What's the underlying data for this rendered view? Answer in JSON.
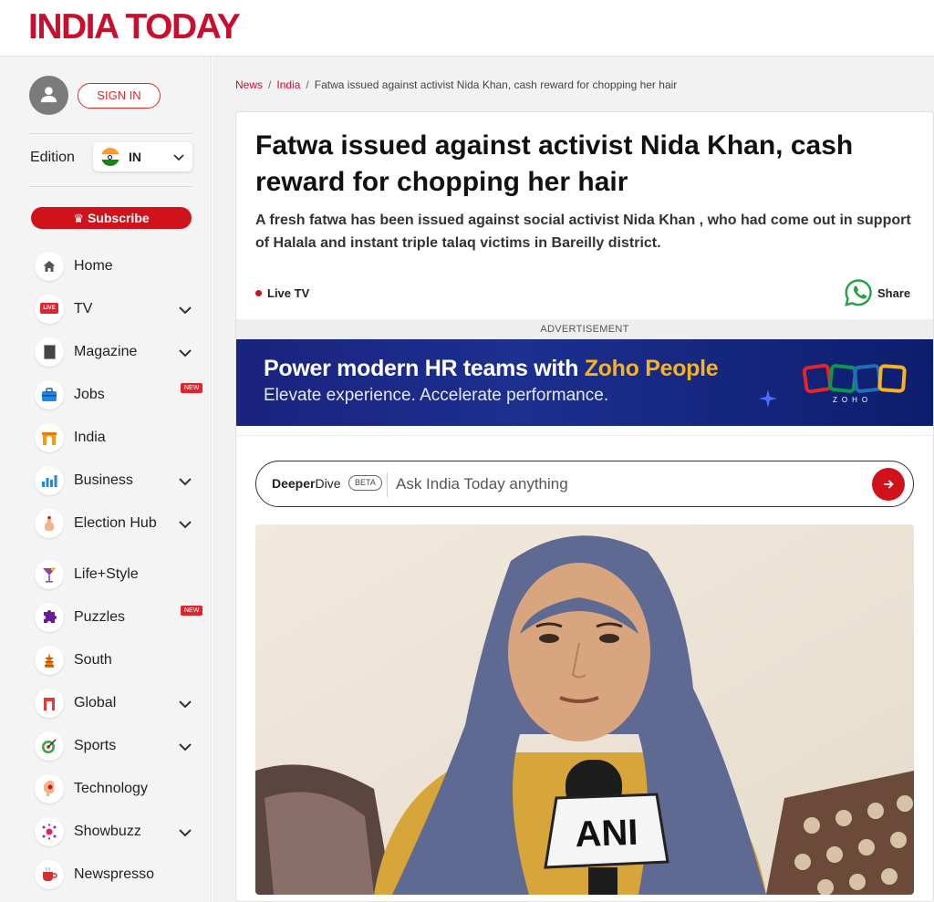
{
  "header": {
    "logo": "INDIA TODAY"
  },
  "sidebar": {
    "signin_label": "SIGN IN",
    "edition_label": "Edition",
    "edition_code": "IN",
    "subscribe_label": "Subscribe",
    "items": [
      {
        "label": "Home",
        "icon": "home-icon",
        "has_chevron": false
      },
      {
        "label": "TV",
        "icon": "live-tv-icon",
        "icon_text": "LIVE",
        "has_chevron": true
      },
      {
        "label": "Magazine",
        "icon": "magazine-icon",
        "has_chevron": true
      },
      {
        "label": "Jobs",
        "icon": "briefcase-icon",
        "has_chevron": false,
        "badge": "NEW"
      },
      {
        "label": "India",
        "icon": "india-gate-icon",
        "has_chevron": false
      },
      {
        "label": "Business",
        "icon": "bar-chart-icon",
        "has_chevron": true
      },
      {
        "label": "Election Hub",
        "icon": "voting-hand-icon",
        "has_chevron": true
      },
      {
        "label": "Life+Style",
        "icon": "cocktail-icon",
        "has_chevron": false
      },
      {
        "label": "Puzzles",
        "icon": "puzzle-icon",
        "has_chevron": false,
        "badge": "NEW"
      },
      {
        "label": "South",
        "icon": "temple-icon",
        "has_chevron": false
      },
      {
        "label": "Global",
        "icon": "globe-gate-icon",
        "has_chevron": true
      },
      {
        "label": "Sports",
        "icon": "target-icon",
        "has_chevron": true
      },
      {
        "label": "Technology",
        "icon": "brain-chip-icon",
        "has_chevron": false
      },
      {
        "label": "Showbuzz",
        "icon": "sparkle-icon",
        "has_chevron": true
      },
      {
        "label": "Newspresso",
        "icon": "coffee-cup-icon",
        "has_chevron": false
      }
    ]
  },
  "breadcrumb": {
    "items": [
      "News",
      "India"
    ],
    "current": "Fatwa issued against activist Nida Khan, cash reward for chopping her hair",
    "separator": "/"
  },
  "article": {
    "headline": "Fatwa issued against activist Nida Khan, cash reward for chopping her hair",
    "summary": "A fresh fatwa has been issued against social activist Nida Khan , who had come out in support of Halala and instant triple talaq victims in Bareilly district.",
    "live_tv_label": "Live TV",
    "share_label": "Share"
  },
  "ad": {
    "label": "ADVERTISEMENT",
    "title_prefix": "Power modern HR teams with ",
    "title_highlight": "Zoho People",
    "subtitle": "Elevate experience. Accelerate performance.",
    "brand": "ZOHO"
  },
  "ask": {
    "brand_bold": "Deeper",
    "brand_regular": "Dive",
    "beta_label": "BETA",
    "placeholder": "Ask India Today anything"
  },
  "photo": {
    "mic_label": "ANI"
  },
  "colors": {
    "brand_red": "#c8102e",
    "button_red": "#d0121b",
    "ad_blue": "#1a237e",
    "ad_yellow": "#f9b21d"
  }
}
